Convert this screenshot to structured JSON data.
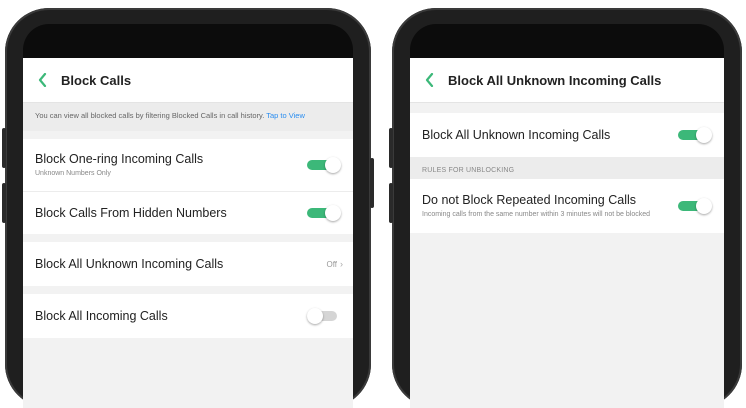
{
  "left_screen": {
    "header": {
      "title": "Block Calls"
    },
    "note": {
      "text": "You can view all blocked calls by filtering Blocked Calls in call history.",
      "link": "Tap to View"
    },
    "rows": [
      {
        "label": "Block One-ring Incoming Calls",
        "sublabel": "Unknown Numbers Only",
        "toggle_on": true
      },
      {
        "label": "Block Calls From Hidden Numbers",
        "toggle_on": true
      },
      {
        "label": "Block All Unknown Incoming Calls",
        "value": "Off"
      },
      {
        "label": "Block All Incoming Calls",
        "toggle_on": false
      }
    ]
  },
  "right_screen": {
    "header": {
      "title": "Block All Unknown Incoming Calls"
    },
    "main_row": {
      "label": "Block All Unknown Incoming Calls",
      "toggle_on": true
    },
    "section_label": "RULES FOR UNBLOCKING",
    "rule_row": {
      "label": "Do not Block Repeated Incoming Calls",
      "sublabel": "Incoming calls from the same number within 3 minutes will not be blocked",
      "toggle_on": true
    }
  },
  "colors": {
    "accent": "#3cb879",
    "toggle_off": "#d5d5d5",
    "link": "#2a8df0",
    "back_arrow": "#3cb879"
  },
  "icons": {
    "back": "chevron-left-icon",
    "row_chevron": "chevron-right-icon"
  }
}
